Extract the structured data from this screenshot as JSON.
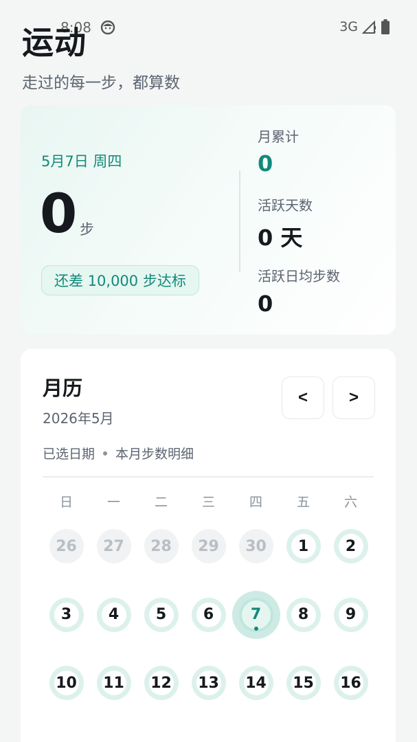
{
  "status_bar": {
    "time": "8:08",
    "network": "3G"
  },
  "header": {
    "title": "运动",
    "subtitle": "走过的每一步，都算数"
  },
  "summary": {
    "date": "5月7日 周四",
    "steps": "0",
    "steps_unit": "步",
    "goal_text": "还差 10,000 步达标",
    "stats": [
      {
        "label": "月累计",
        "value": "0"
      },
      {
        "label": "活跃天数",
        "value": "0 天"
      },
      {
        "label": "活跃日均步数",
        "value": "0"
      }
    ]
  },
  "calendar": {
    "title": "月历",
    "month": "2026年5月",
    "prev_label": "<",
    "next_label": ">",
    "hint_selected": "已选日期",
    "hint_detail": "本月步数明细",
    "weekdays": [
      "日",
      "一",
      "二",
      "三",
      "四",
      "五",
      "六"
    ],
    "days": [
      "26",
      "27",
      "28",
      "29",
      "30",
      "1",
      "2",
      "3",
      "4",
      "5",
      "6",
      "7",
      "8",
      "9",
      "10",
      "11",
      "12",
      "13",
      "14",
      "15",
      "16"
    ],
    "other_month_count": 5,
    "selected_day": "7"
  },
  "colors": {
    "accent": "#11897a",
    "ring": "#dcf1eb",
    "background": "#f4f6f5"
  }
}
